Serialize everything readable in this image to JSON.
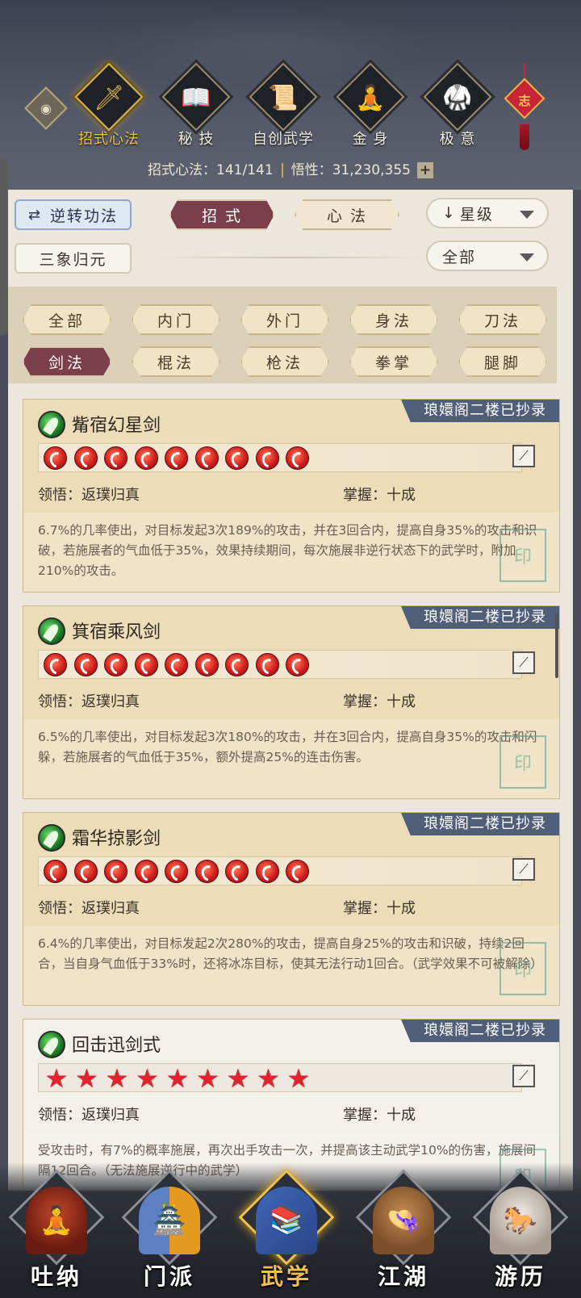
{
  "top_nav": {
    "eye_icon": "eye-icon",
    "items": [
      {
        "label": "招式心法",
        "icon": "sword-icon",
        "active": true
      },
      {
        "label": "秘 技",
        "icon": "book-icon",
        "active": false
      },
      {
        "label": "自创武学",
        "icon": "scroll-icon",
        "active": false
      },
      {
        "label": "金 身",
        "icon": "meditation-icon",
        "active": false
      },
      {
        "label": "极 意",
        "icon": "martial-stance-icon",
        "active": false
      }
    ],
    "knot_char": "志"
  },
  "stats": {
    "skills_label": "招式心法：",
    "skills_value": "141/141",
    "insight_label": "悟性：",
    "insight_value": "31,230,355",
    "plus": "+"
  },
  "controls": {
    "reverse_btn": "逆转功法",
    "tab_moves": "招 式",
    "tab_mind": "心 法",
    "sort_select": "星级",
    "sanxiang_btn": "三象归元",
    "filter_select": "全部"
  },
  "filters": [
    "全部",
    "内门",
    "外门",
    "身法",
    "刀法",
    "剑法",
    "棍法",
    "枪法",
    "拳掌",
    "腿脚"
  ],
  "active_filter": "剑法",
  "cards": [
    {
      "name": "觜宿幻星剑",
      "ribbon": "琅嬛阁二楼已抄录",
      "stars": 9,
      "star_type": "flame",
      "weapon_icon": "sword-slot-icon",
      "comprehension_label": "领悟：",
      "comprehension": "返璞归真",
      "mastery_label": "掌握：",
      "mastery": "十成",
      "desc": "6.7%的几率使出，对目标发起3次189%的攻击，并在3回合内，提高自身35%的攻击和识破，若施展者的气血低于35%，效果持续期间，每次施展非逆行状态下的武学时，附加210%的攻击。",
      "white": false
    },
    {
      "name": "箕宿乘风剑",
      "ribbon": "琅嬛阁二楼已抄录",
      "stars": 9,
      "star_type": "flame",
      "weapon_icon": "sword-slot-icon",
      "comprehension_label": "领悟：",
      "comprehension": "返璞归真",
      "mastery_label": "掌握：",
      "mastery": "十成",
      "desc": "6.5%的几率使出，对目标发起3次180%的攻击，并在3回合内，提高自身35%的攻击和闪躲，若施展者的气血低于35%，额外提高25%的连击伤害。",
      "white": false
    },
    {
      "name": "霜华掠影剑",
      "ribbon": "琅嬛阁二楼已抄录",
      "stars": 9,
      "star_type": "flame",
      "weapon_icon": "sword-slot-icon",
      "comprehension_label": "领悟：",
      "comprehension": "返璞归真",
      "mastery_label": "掌握：",
      "mastery": "十成",
      "desc": "6.4%的几率使出，对目标发起2次280%的攻击，提高自身25%的攻击和识破，持续2回合，当自身气血低于33%时，还将冰冻目标，使其无法行动1回合。（武学效果不可被解除）",
      "white": false
    },
    {
      "name": "回击迅剑式",
      "ribbon": "琅嬛阁二楼已抄录",
      "stars": 9,
      "star_type": "star",
      "weapon_icon": "sword-slot-icon",
      "comprehension_label": "领悟：",
      "comprehension": "返璞归真",
      "mastery_label": "掌握：",
      "mastery": "十成",
      "desc": "受攻击时，有7%的概率施展，再次出手攻击一次，并提高该主动武学10%的伤害，施展间隔12回合。（无法施展逆行中的武学）",
      "white": true
    }
  ],
  "bottom_nav": [
    {
      "label": "吐纳",
      "icon": "monk-icon",
      "active": false
    },
    {
      "label": "门派",
      "icon": "sect-banner-icon",
      "active": false
    },
    {
      "label": "武学",
      "icon": "manual-books-icon",
      "active": true
    },
    {
      "label": "江湖",
      "icon": "straw-hat-icon",
      "active": false
    },
    {
      "label": "游历",
      "icon": "horse-icon",
      "active": false
    }
  ],
  "colors": {
    "accent_gold": "#f0c04e",
    "maroon": "#7a3f4b",
    "ribbon_blue": "#4f5f7a",
    "star_red": "#d31d1d"
  }
}
